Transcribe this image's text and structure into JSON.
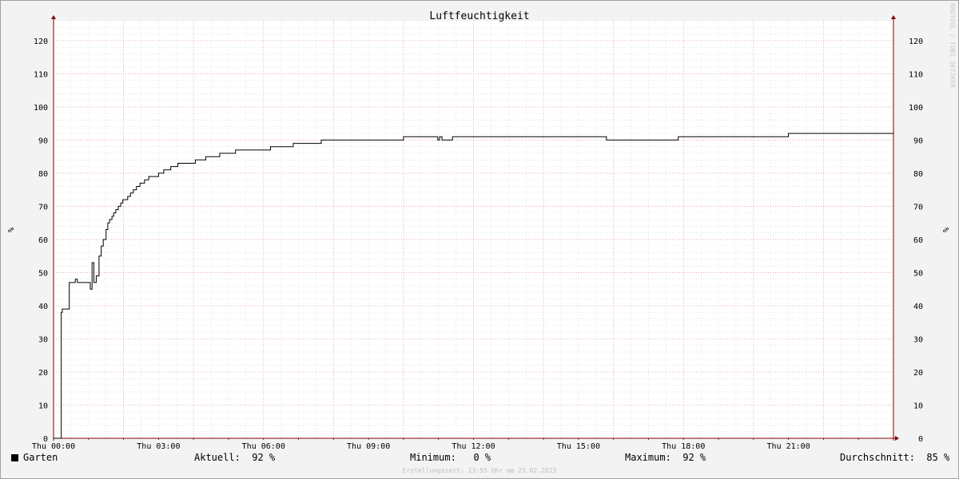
{
  "watermark": "RRDTOOL / TOBI OETIKER",
  "footer": "Erstellungszeit: 23:55 Uhr am 23.02.2023",
  "legend": {
    "series_name": "Garten",
    "current_label": "Aktuell:",
    "current_value": "92 %",
    "min_label": "Minimum:",
    "min_value": "0 %",
    "max_label": "Maximum:",
    "max_value": "92 %",
    "avg_label": "Durchschnitt:",
    "avg_value": "85 %"
  },
  "colors": {
    "background": "#f3f3f3",
    "plot_background": "#ffffff",
    "major_grid": "#e6a0a0",
    "minor_grid": "#d8d8d8",
    "line": "#000000",
    "axis": "#800000"
  },
  "chart_data": {
    "type": "line",
    "title": "Luftfeuchtigkeit",
    "ylabel": "%",
    "ylim": [
      0,
      126
    ],
    "xlim": [
      0,
      24
    ],
    "x_unit": "hours since Thu 00:00",
    "x_tick_labels": [
      "Thu 00:00",
      "Thu 03:00",
      "Thu 06:00",
      "Thu 09:00",
      "Thu 12:00",
      "Thu 15:00",
      "Thu 18:00",
      "Thu 21:00"
    ],
    "x_tick_hours": [
      0,
      3,
      6,
      9,
      12,
      15,
      18,
      21
    ],
    "y_ticks": [
      0,
      10,
      20,
      30,
      40,
      50,
      60,
      70,
      80,
      90,
      100,
      110,
      120
    ],
    "grid": true,
    "series": [
      {
        "name": "Garten",
        "step": true,
        "x": [
          0,
          0.22,
          0.25,
          0.32,
          0.45,
          0.62,
          0.68,
          0.75,
          1.05,
          1.1,
          1.15,
          1.22,
          1.3,
          1.36,
          1.42,
          1.5,
          1.55,
          1.6,
          1.67,
          1.72,
          1.78,
          1.85,
          1.92,
          1.98,
          2.05,
          2.12,
          2.2,
          2.28,
          2.37,
          2.47,
          2.6,
          2.72,
          2.85,
          3.0,
          3.15,
          3.35,
          3.55,
          3.8,
          4.05,
          4.35,
          4.75,
          5.2,
          5.7,
          6.2,
          6.85,
          7.65,
          8.65,
          10.0,
          10.98,
          11.03,
          11.1,
          11.15,
          11.4,
          15.8,
          17.85,
          21.0,
          24.0
        ],
        "values": [
          0,
          38,
          39,
          39,
          47,
          48,
          47,
          47,
          45,
          53,
          47,
          49,
          55,
          58,
          60,
          63,
          65,
          66,
          67,
          68,
          69,
          70,
          71,
          72,
          72,
          73,
          74,
          75,
          76,
          77,
          78,
          79,
          79,
          80,
          81,
          82,
          83,
          83,
          84,
          85,
          86,
          87,
          87,
          88,
          89,
          90,
          90,
          91,
          90,
          91,
          90,
          90,
          91,
          90,
          91,
          92,
          92
        ]
      }
    ]
  }
}
